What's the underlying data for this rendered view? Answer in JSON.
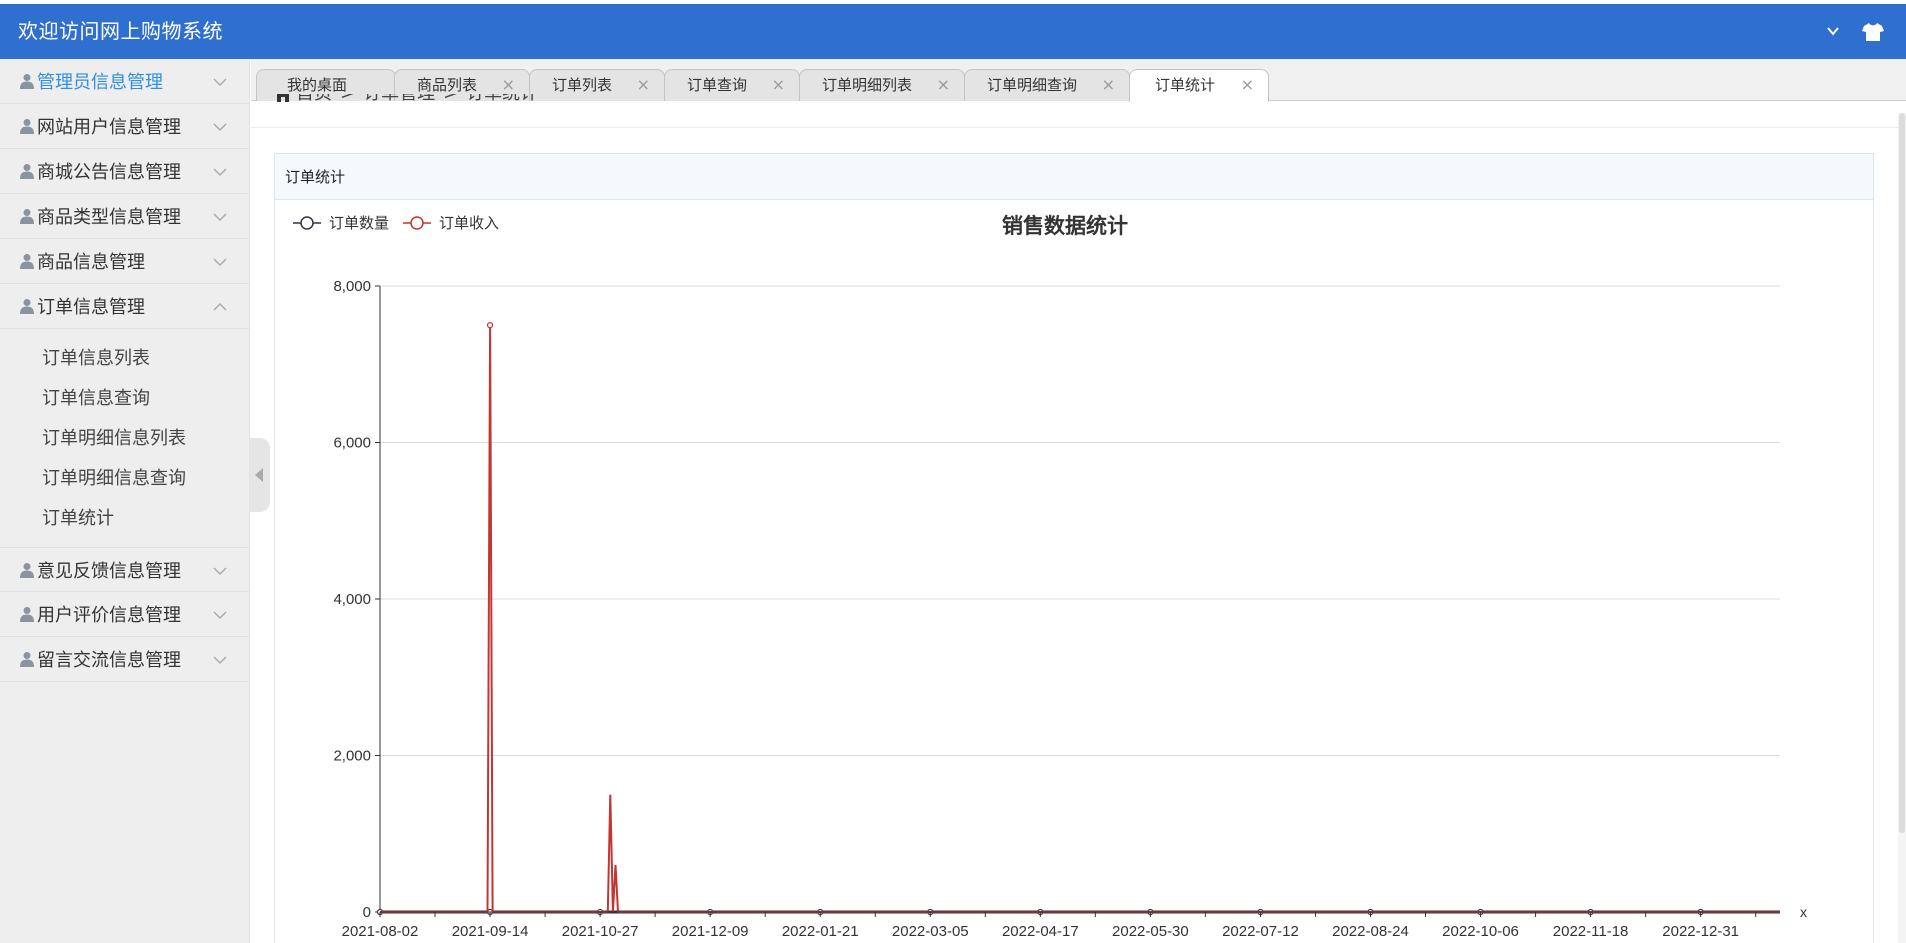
{
  "header": {
    "title": "欢迎访问网上购物系统",
    "menu_icon": "chevron-down-icon",
    "skin_icon": "tshirt-icon",
    "bg_color": "#2f6fcf"
  },
  "sidebar": {
    "items": [
      {
        "label": "管理员信息管理",
        "active": true
      },
      {
        "label": "网站用户信息管理"
      },
      {
        "label": "商城公告信息管理"
      },
      {
        "label": "商品类型信息管理"
      },
      {
        "label": "商品信息管理"
      },
      {
        "label": "订单信息管理",
        "expanded": true
      },
      {
        "label": "意见反馈信息管理"
      },
      {
        "label": "用户评价信息管理"
      },
      {
        "label": "留言交流信息管理"
      }
    ],
    "submenu": [
      "订单信息列表",
      "订单信息查询",
      "订单明细信息列表",
      "订单明细信息查询",
      "订单统计"
    ],
    "active_color": "#2f8fe0"
  },
  "tabs": [
    {
      "label": "我的桌面",
      "closable": false
    },
    {
      "label": "商品列表",
      "closable": true
    },
    {
      "label": "订单列表",
      "closable": true
    },
    {
      "label": "订单查询",
      "closable": true
    },
    {
      "label": "订单明细列表",
      "closable": true
    },
    {
      "label": "订单明细查询",
      "closable": true
    },
    {
      "label": "订单统计",
      "closable": true,
      "active": true
    }
  ],
  "tab_close_glyph": "×",
  "breadcrumb": [
    "首页",
    "订单管理",
    "订单统计"
  ],
  "breadcrumb_sep": ">",
  "panel": {
    "title": "订单统计"
  },
  "chart_data": {
    "type": "line",
    "title": "销售数据统计",
    "xlabel": "x",
    "ylabel": "",
    "ylim": [
      0,
      8000
    ],
    "yticks": [
      "0",
      "2,000",
      "4,000",
      "6,000",
      "8,000"
    ],
    "xticks": [
      "2021-08-02",
      "2021-09-14",
      "2021-10-27",
      "2021-12-09",
      "2022-01-21",
      "2022-03-05",
      "2022-04-17",
      "2022-05-30",
      "2022-07-12",
      "2022-08-24",
      "2022-10-06",
      "2022-11-18",
      "2022-12-31"
    ],
    "x_range": [
      "2021-08-02",
      "2023-01-31"
    ],
    "series": [
      {
        "name": "订单数量",
        "color": "#333344",
        "points": [
          [
            "2021-08-02",
            0
          ],
          [
            "2021-09-14",
            0
          ],
          [
            "2021-10-27",
            0
          ],
          [
            "2021-12-09",
            0
          ],
          [
            "2022-01-21",
            0
          ],
          [
            "2022-03-05",
            0
          ],
          [
            "2022-04-17",
            0
          ],
          [
            "2022-05-30",
            0
          ],
          [
            "2022-07-12",
            0
          ],
          [
            "2022-08-24",
            0
          ],
          [
            "2022-10-06",
            0
          ],
          [
            "2022-11-18",
            0
          ],
          [
            "2022-12-31",
            0
          ],
          [
            "2023-01-31",
            0
          ]
        ],
        "markers": [
          "2021-08-02",
          "2021-09-14",
          "2021-10-27",
          "2021-12-09",
          "2022-01-21",
          "2022-03-05",
          "2022-04-17",
          "2022-05-30",
          "2022-07-12",
          "2022-08-24",
          "2022-10-06",
          "2022-11-18",
          "2022-12-31"
        ]
      },
      {
        "name": "订单收入",
        "color": "#c23531",
        "points": [
          [
            "2021-08-02",
            0
          ],
          [
            "2021-09-13",
            0
          ],
          [
            "2021-09-14",
            7500
          ],
          [
            "2021-09-15",
            0
          ],
          [
            "2021-10-30",
            0
          ],
          [
            "2021-10-31",
            1500
          ],
          [
            "2021-11-01",
            0
          ],
          [
            "2021-11-02",
            600
          ],
          [
            "2021-11-03",
            0
          ],
          [
            "2023-01-31",
            0
          ]
        ],
        "markers": [
          "2021-09-14"
        ]
      }
    ],
    "legend_position": "top-left",
    "grid": "horizontal"
  }
}
